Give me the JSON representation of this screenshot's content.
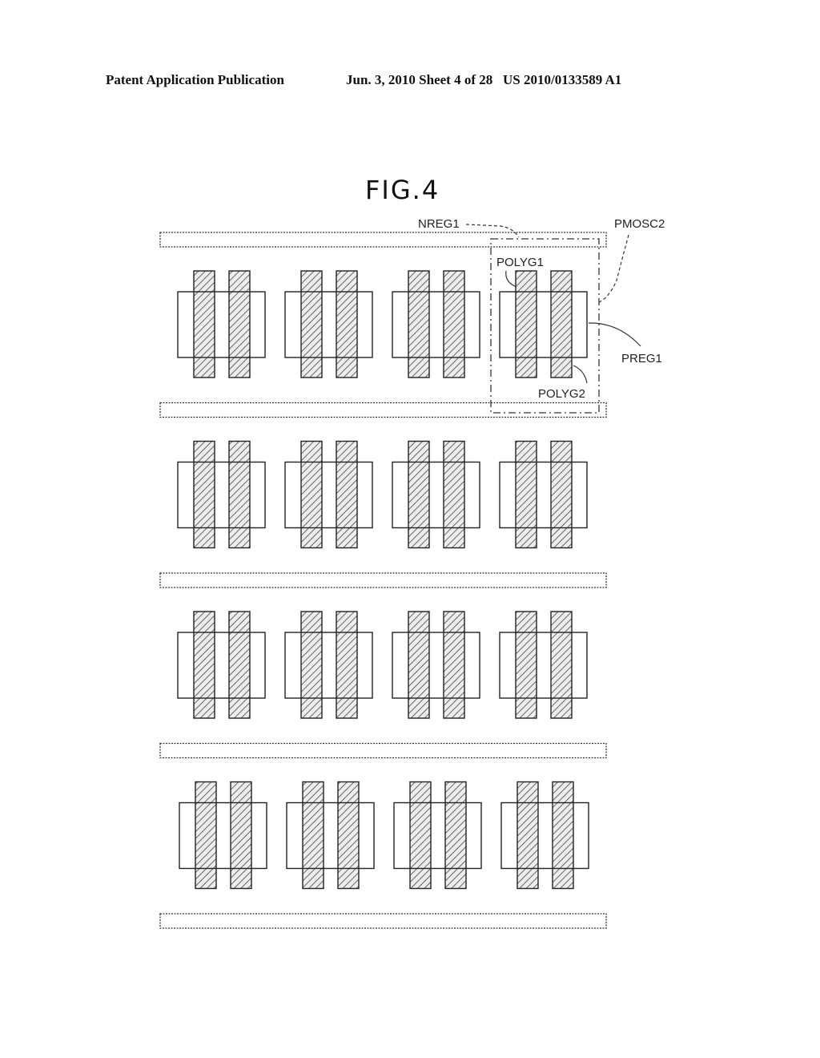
{
  "header": {
    "left": "Patent Application Publication",
    "middle": "Jun. 3, 2010   Sheet 4 of 28",
    "right": "US 2010/0133589 A1"
  },
  "figure": {
    "title": "FIG.4",
    "rows": 4,
    "cells_per_row": 4,
    "gates_per_cell": 2,
    "rails": 5,
    "labels": {
      "nreg": "NREG1",
      "pmosc": "PMOSC2",
      "polyg1": "POLYG1",
      "polyg2": "POLYG2",
      "preg": "PREG1"
    }
  },
  "colors": {
    "ink": "#222222",
    "hatch": "#555555",
    "fill": "#e6e6e6"
  }
}
